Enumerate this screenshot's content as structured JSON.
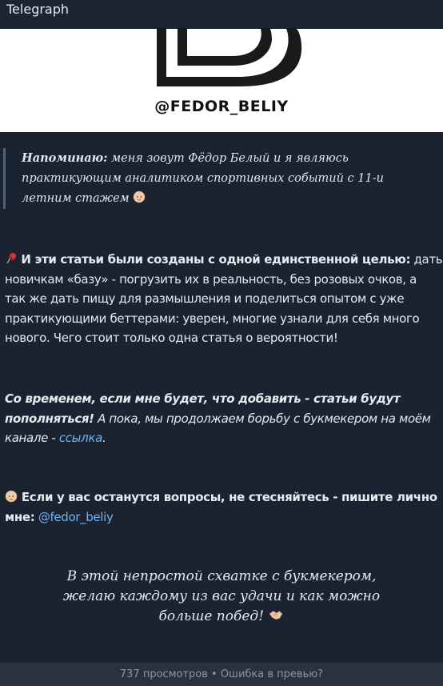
{
  "window": {
    "title": "Telegraph"
  },
  "banner": {
    "handle": "@FEDOR_BELIY"
  },
  "quote": {
    "lead": "Напоминаю:",
    "line1": " меня зовут Фёдор Белый и я являюсь",
    "line2": "практикующим аналитиком спортивных событий с 11-и",
    "line3": "летним стажем"
  },
  "paragraph1": {
    "bold": "И эти статьи были созданы с одной единственной целью:",
    "line1_rest": " дать",
    "line2": "новичкам «базу» - погрузить их в реальность, без розовых очков, а",
    "line3": "так же дать пищу для размышления и поделиться опытом с уже",
    "line4": "практикующими беттерами: уверен, многие узнали для себя много",
    "line5": "нового. Чего стоит только одна статья о вероятности!"
  },
  "paragraph2": {
    "bold_line1": "Со временем, если мне будет, что добавить - статьи будут",
    "bold_line2": "пополняться!",
    "line2_rest": " А пока, мы продолжаем борьбу с букмекером на моём",
    "line3": "канале - ",
    "link": "ссылка",
    "tail": "."
  },
  "paragraph3": {
    "bold_line1": " Если у вас останутся вопросы, не стесняйтесь - пишите лично",
    "bold_line2": "мне:",
    "mention": "@fedor_beliy"
  },
  "closing": {
    "line1": "В этой непростой схватке с букмекером,",
    "line2": "желаю каждому из вас удачи и как можно",
    "line3": "больше побед!"
  },
  "footer": {
    "views": "737 просмотров",
    "separator": " • ",
    "report": "Ошибка в превью?"
  },
  "colors": {
    "background": "#1b2230",
    "link": "#6fb4f3",
    "quote_bar": "#4d6179",
    "footer": "#2a3240"
  }
}
